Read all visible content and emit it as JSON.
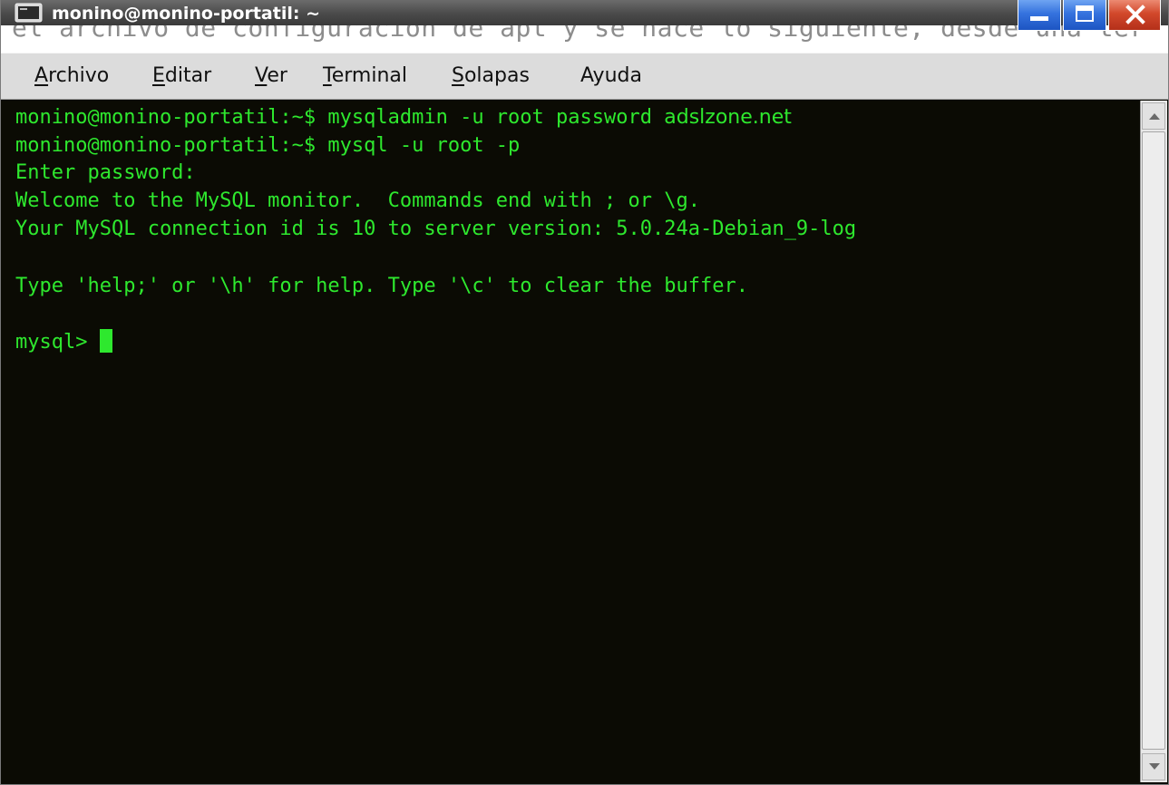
{
  "window": {
    "title": "monino@monino-portatil: ~",
    "background_text": "el archivo de configuracion de apt y se hace lo siguiente, desde una ter",
    "title_icon": "terminal-icon",
    "controls": {
      "minimize_icon": "minimize-icon",
      "maximize_icon": "maximize-icon",
      "close_icon": "close-icon"
    }
  },
  "menu": [
    {
      "mnemonic": "A",
      "rest": "rchivo"
    },
    {
      "mnemonic": "E",
      "rest": "ditar"
    },
    {
      "mnemonic": "V",
      "rest": "er"
    },
    {
      "mnemonic": "T",
      "rest": "erminal"
    },
    {
      "mnemonic": "S",
      "rest": "olapas"
    },
    {
      "mnemonic": "",
      "rest": "Ayuda"
    }
  ],
  "terminal": {
    "lines": [
      {
        "prompt": "monino@monino-portatil:~$ ",
        "command": "mysqladmin -u root password ",
        "arg": "adslzone.net"
      },
      {
        "prompt": "monino@monino-portatil:~$ ",
        "command": "mysql -u root -p"
      },
      {
        "text": "Enter password:"
      },
      {
        "text": "Welcome to the MySQL monitor.  Commands end with ; or \\g."
      },
      {
        "text": "Your MySQL connection id is 10 to server version: 5.0.24a-Debian_9-log"
      },
      {
        "text": ""
      },
      {
        "text": "Type 'help;' or '\\h' for help. Type '\\c' to clear the buffer."
      },
      {
        "text": ""
      },
      {
        "prompt": "mysql> ",
        "cursor": true
      }
    ]
  },
  "colors": {
    "terminal_bg": "#0b0b04",
    "terminal_fg": "#2ee82e",
    "menubar_bg": "#dcdcdc",
    "titlebar_bg": "#4a4a4a"
  }
}
